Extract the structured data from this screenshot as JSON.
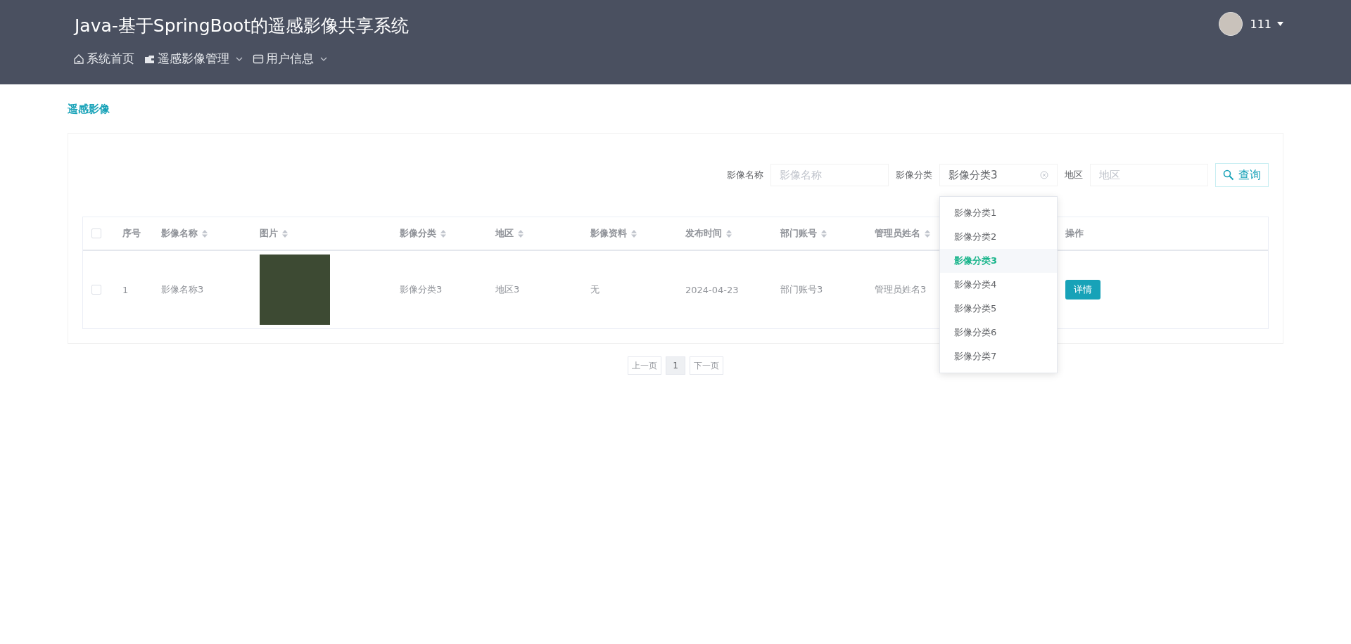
{
  "header": {
    "title": "Java-基于SpringBoot的遥感影像共享系统",
    "user": {
      "name": "111"
    },
    "nav": [
      {
        "label": "系统首页",
        "has_menu": false
      },
      {
        "label": "遥感影像管理",
        "has_menu": true
      },
      {
        "label": "用户信息",
        "has_menu": true
      }
    ]
  },
  "breadcrumb": "遥感影像",
  "search": {
    "fields": [
      {
        "label": "影像名称",
        "placeholder": "影像名称"
      },
      {
        "label": "影像分类",
        "value": "影像分类3",
        "kind": "select"
      },
      {
        "label": "地区",
        "placeholder": "地区"
      }
    ],
    "button": "查询",
    "dropdown": [
      {
        "label": "影像分类1",
        "selected": false
      },
      {
        "label": "影像分类2",
        "selected": false
      },
      {
        "label": "影像分类3",
        "selected": true
      },
      {
        "label": "影像分类4",
        "selected": false
      },
      {
        "label": "影像分类5",
        "selected": false
      },
      {
        "label": "影像分类6",
        "selected": false
      },
      {
        "label": "影像分类7",
        "selected": false
      }
    ]
  },
  "table": {
    "all_checked": false,
    "columns": [
      {
        "label": "序号",
        "sortable": false
      },
      {
        "label": "影像名称",
        "sortable": true
      },
      {
        "label": "图片",
        "sortable": true
      },
      {
        "label": "影像分类",
        "sortable": true
      },
      {
        "label": "地区",
        "sortable": true
      },
      {
        "label": "影像资料",
        "sortable": true
      },
      {
        "label": "发布时间",
        "sortable": true
      },
      {
        "label": "部门账号",
        "sortable": true
      },
      {
        "label": "管理员姓名",
        "sortable": true
      },
      {
        "label": "操作",
        "sortable": false
      }
    ],
    "rows": [
      {
        "checked": false,
        "index": "1",
        "name": "影像名称3",
        "category": "影像分类3",
        "region": "地区3",
        "material": "无",
        "date": "2024-04-23",
        "account": "部门账号3",
        "admin": "管理员姓名3",
        "action": "详情"
      }
    ]
  },
  "pagination": {
    "prev": "上一页",
    "pages": [
      {
        "label": "1",
        "selected": true
      }
    ],
    "next": "下一页"
  }
}
